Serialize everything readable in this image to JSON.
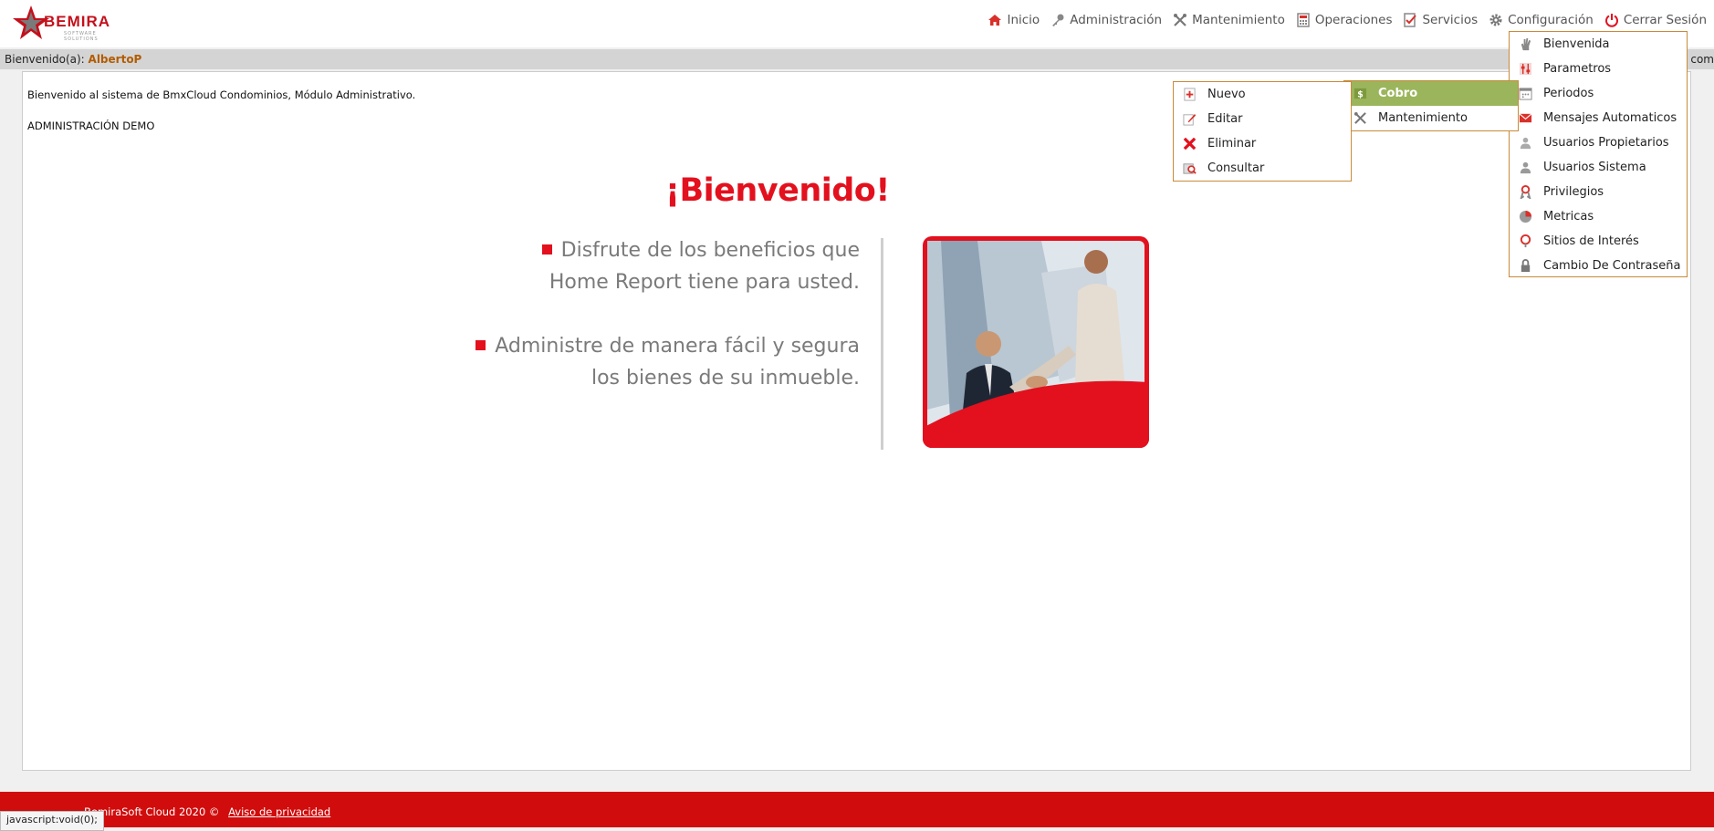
{
  "brand": {
    "name": "BEMIRA",
    "tagline": "SOFTWARE SOLUTIONS"
  },
  "nav": [
    {
      "label": "Inicio",
      "icon": "home-icon"
    },
    {
      "label": "Administración",
      "icon": "key-icon"
    },
    {
      "label": "Mantenimiento",
      "icon": "tools-icon"
    },
    {
      "label": "Operaciones",
      "icon": "calculator-icon"
    },
    {
      "label": "Servicios",
      "icon": "checklist-icon"
    },
    {
      "label": "Configuración",
      "icon": "gear-icon"
    },
    {
      "label": "Cerrar Sesión",
      "icon": "power-icon"
    }
  ],
  "welcome_bar": {
    "label": "Bienvenido(a):",
    "user": "AlbertoP",
    "suffix": "com"
  },
  "main": {
    "intro": "Bienvenido al sistema de BmxCloud Condominios, Módulo Administrativo.",
    "org": "ADMINISTRACIÓN DEMO",
    "hero_title": "¡Bienvenido!",
    "bullet1_line1": "Disfrute de los beneficios que",
    "bullet1_line2": "Home Report tiene para usted.",
    "bullet2_line1": "Administre de manera fácil y segura",
    "bullet2_line2": "los bienes de su inmueble."
  },
  "config_menu": [
    {
      "label": "Bienvenida",
      "icon": "hand-icon"
    },
    {
      "label": "Parametros",
      "icon": "sliders-icon"
    },
    {
      "label": "Periodos",
      "icon": "calendar-icon"
    },
    {
      "label": "Mensajes Automaticos",
      "icon": "envelope-icon"
    },
    {
      "label": "Usuarios Propietarios",
      "icon": "user-owner-icon"
    },
    {
      "label": "Usuarios Sistema",
      "icon": "user-system-icon"
    },
    {
      "label": "Privilegios",
      "icon": "ribbon-icon"
    },
    {
      "label": "Metricas",
      "icon": "pie-chart-icon"
    },
    {
      "label": "Sitios de Interés",
      "icon": "pin-icon"
    },
    {
      "label": "Cambio De Contraseña",
      "icon": "lock-icon"
    }
  ],
  "ops_menu": [
    {
      "label": "Cobro",
      "icon": "money-icon",
      "active": true
    },
    {
      "label": "Mantenimiento",
      "icon": "tools-icon",
      "active": false
    }
  ],
  "sub_menu": [
    {
      "label": "Nuevo",
      "icon": "new-doc-icon"
    },
    {
      "label": "Editar",
      "icon": "edit-icon"
    },
    {
      "label": "Eliminar",
      "icon": "delete-icon"
    },
    {
      "label": "Consultar",
      "icon": "search-doc-icon"
    }
  ],
  "footer": {
    "copyright": "BemiraSoft Cloud 2020 ©",
    "privacy_link": "Aviso de privacidad"
  },
  "status_tip": "javascript:void(0);",
  "colors": {
    "brand_red": "#e3101e",
    "footer_red": "#d00c0c",
    "menu_active": "#9bb55c",
    "menu_border": "#c98a3a"
  }
}
